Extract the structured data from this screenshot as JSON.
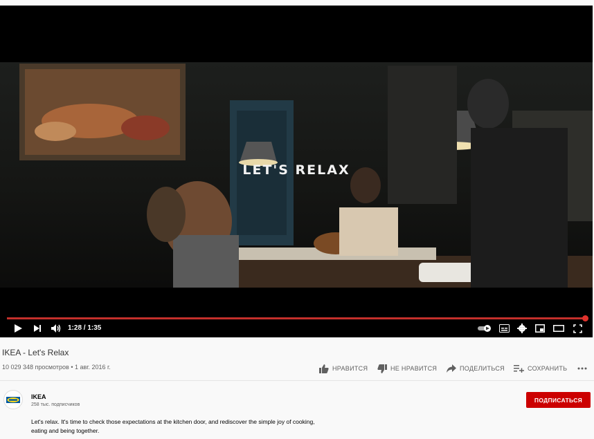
{
  "player": {
    "overlay_title": "LET'S RELAX",
    "time": "1:28 / 1:35",
    "progress": 0.926,
    "icons": [
      "play-icon",
      "next-icon",
      "volume-icon",
      "autoplay-toggle-icon",
      "subtitles-icon",
      "settings-icon",
      "miniplayer-icon",
      "theater-mode-icon",
      "fullscreen-icon"
    ],
    "progress_color": "#c4302b"
  },
  "video": {
    "title": "IKEA - Let's Relax",
    "views_date": "10 029 348 просмотров • 1 авг. 2016 г."
  },
  "actions": {
    "like": "НРАВИТСЯ",
    "dislike": "НЕ НРАВИТСЯ",
    "share": "ПОДЕЛИТЬСЯ",
    "save": "СОХРАНИТЬ"
  },
  "channel": {
    "name": "IKEA",
    "subscribers": "258 тыс. подписчиков",
    "subscribe_label": "ПОДПИСАТЬСЯ",
    "subscribe_color": "#cc0000"
  },
  "description": "Let's relax. It's time to check those expectations at the kitchen door, and rediscover the simple joy of cooking, eating and being together."
}
